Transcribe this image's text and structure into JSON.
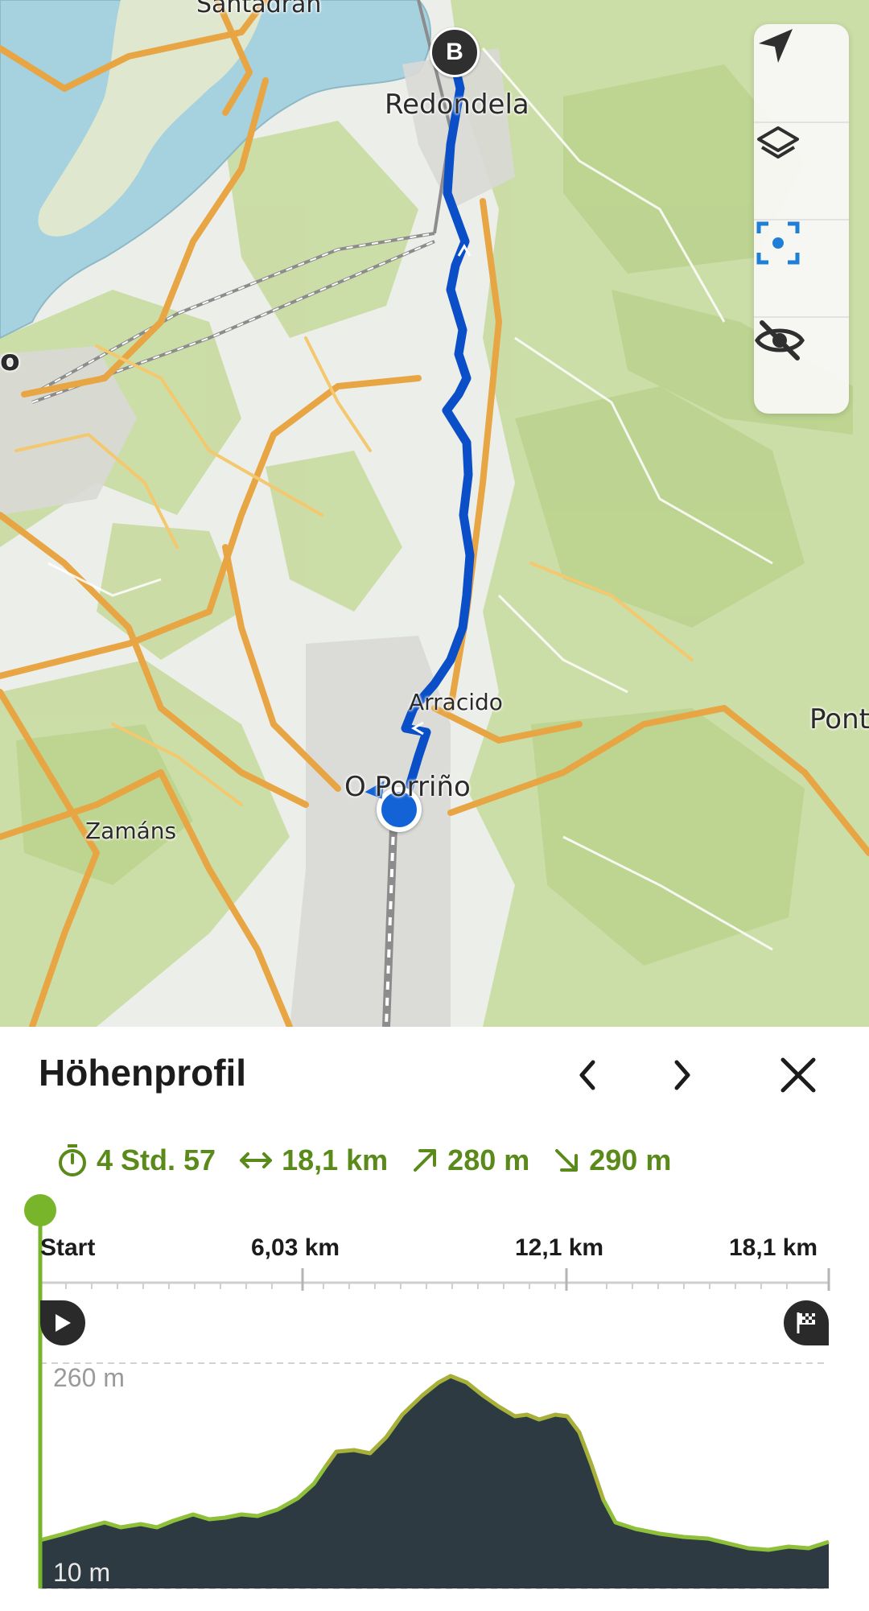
{
  "map": {
    "labels": {
      "santadran": "Santadrán",
      "redondela": "Redondela",
      "o_left": "o",
      "arracido": "Arracido",
      "pont": "Pont",
      "porrino": "O Porriño",
      "zamans": "Zamáns"
    },
    "end_marker": "B",
    "route_color": "#0a4fc8"
  },
  "controls": {
    "items": [
      "navigate-icon",
      "layers-icon",
      "locate-icon",
      "hide-icon"
    ],
    "accent": "#1f7fd6"
  },
  "panel": {
    "title": "Höhenprofil",
    "nav": [
      "chevron-left-icon",
      "chevron-right-icon",
      "close-icon"
    ]
  },
  "stats": {
    "duration": "4 Std. 57",
    "distance": "18,1 km",
    "ascent": "280 m",
    "descent": "290 m",
    "color": "#5a8a1a"
  },
  "profile": {
    "ticks": [
      "Start",
      "6,03 km",
      "12,1 km",
      "18,1 km"
    ],
    "elevation_max_label": "260 m",
    "elevation_min_label": "10 m",
    "fill_color": "#2e3a42",
    "line_color": "#8fc03a",
    "cursor_color": "#79b52b"
  }
}
